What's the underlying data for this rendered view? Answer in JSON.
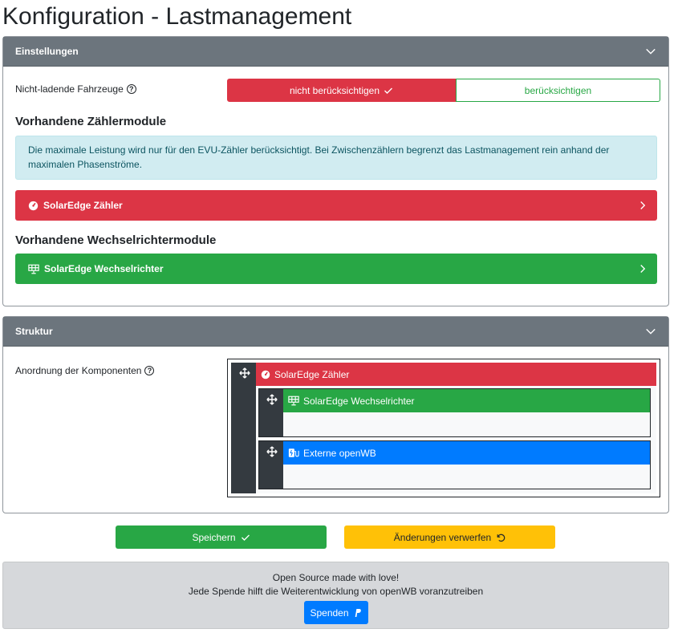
{
  "page_title": "Konfiguration - Lastmanagement",
  "settings": {
    "header": "Einstellungen",
    "nonloading_label": "Nicht-ladende Fahrzeuge",
    "option_ignore": "nicht berücksichtigen",
    "option_consider": "berücksichtigen",
    "counter_modules_title": "Vorhandene Zählermodule",
    "info_text": "Die maximale Leistung wird nur für den EVU-Zähler berücksichtigt. Bei Zwischenzählern begrenzt das Lastmanagement rein anhand der maximalen Phasenströme.",
    "counter_module": "SolarEdge Zähler",
    "inverter_modules_title": "Vorhandene Wechselrichtermodule",
    "inverter_module": "SolarEdge Wechselrichter"
  },
  "structure": {
    "header": "Struktur",
    "arrangement_label": "Anordnung der Komponenten",
    "root_node": "SolarEdge Zähler",
    "child_inverter": "SolarEdge Wechselrichter",
    "child_openwb": "Externe openWB"
  },
  "actions": {
    "save": "Speichern",
    "discard": "Änderungen verwerfen"
  },
  "footer": {
    "line1": "Open Source made with love!",
    "line2": "Jede Spende hilft die Weiterentwicklung von openWB voranzutreiben",
    "donate": "Spenden"
  },
  "colors": {
    "danger": "#dc3545",
    "success": "#28a745",
    "primary": "#007bff",
    "warning": "#ffc107",
    "header_gray": "#6c757d",
    "info_bg": "#d1ecf1"
  }
}
